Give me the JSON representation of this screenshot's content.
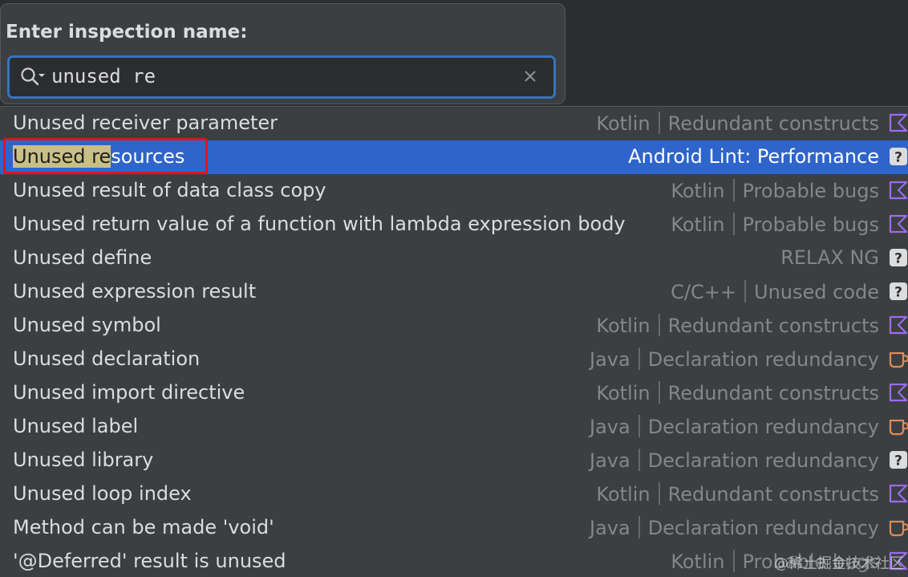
{
  "prompt": "Enter inspection name:",
  "search": {
    "value": "unused re"
  },
  "highlight_text": "Unused re",
  "selected_index": 1,
  "items": [
    {
      "name": "Unused receiver parameter",
      "lang": "Kotlin",
      "category": "Redundant constructs",
      "icon": "kotlin-icon"
    },
    {
      "name": "Unused resources",
      "lang": "",
      "category": "Android Lint: Performance",
      "icon": "question-icon"
    },
    {
      "name": "Unused result of data class copy",
      "lang": "Kotlin",
      "category": "Probable bugs",
      "icon": "kotlin-icon"
    },
    {
      "name": "Unused return value of a function with lambda expression body",
      "lang": "Kotlin",
      "category": "Probable bugs",
      "icon": "kotlin-icon"
    },
    {
      "name": "Unused define",
      "lang": "",
      "category": "RELAX NG",
      "icon": "question-icon"
    },
    {
      "name": "Unused expression result",
      "lang": "C/C++",
      "category": "Unused code",
      "icon": "question-icon"
    },
    {
      "name": "Unused symbol",
      "lang": "Kotlin",
      "category": "Redundant constructs",
      "icon": "kotlin-icon"
    },
    {
      "name": "Unused declaration",
      "lang": "Java",
      "category": "Declaration redundancy",
      "icon": "java-icon"
    },
    {
      "name": "Unused import directive",
      "lang": "Kotlin",
      "category": "Redundant constructs",
      "icon": "kotlin-icon"
    },
    {
      "name": "Unused label",
      "lang": "Java",
      "category": "Declaration redundancy",
      "icon": "java-icon"
    },
    {
      "name": "Unused library",
      "lang": "Java",
      "category": "Declaration redundancy",
      "icon": "question-icon"
    },
    {
      "name": "Unused loop index",
      "lang": "Kotlin",
      "category": "Redundant constructs",
      "icon": "kotlin-icon"
    },
    {
      "name": "Method can be made 'void'",
      "lang": "Java",
      "category": "Declaration redundancy",
      "icon": "java-icon"
    },
    {
      "name": "'@Deferred' result is unused",
      "lang": "Kotlin",
      "category": "Probable bugs",
      "icon": "kotlin-icon"
    }
  ],
  "watermark": "@稀土掘金技术社区",
  "colors": {
    "selection": "#2f65ca",
    "match_highlight": "#c9bf85",
    "focus_border": "#3574c0",
    "annotation": "#e0141e",
    "kotlin": "#9b6bf0",
    "java": "#e08a56"
  }
}
